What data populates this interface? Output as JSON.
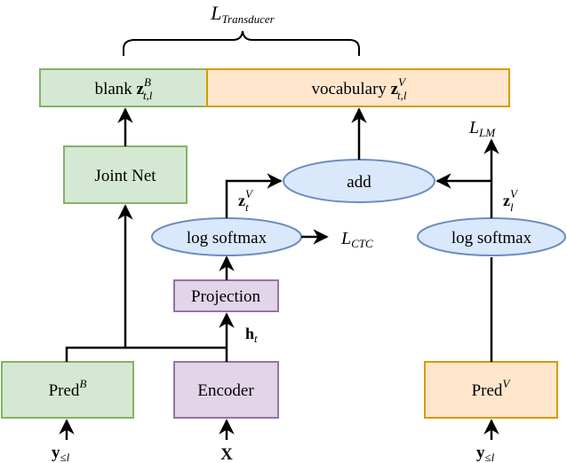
{
  "colors": {
    "green_fill": "#d5e8d4",
    "green_stroke": "#82b366",
    "orange_fill": "#ffe6cc",
    "orange_stroke": "#d79b00",
    "purple_fill": "#e1d5e7",
    "purple_stroke": "#9673a6",
    "blue_fill": "#dae8fc",
    "blue_stroke": "#6c8ebf",
    "line": "#000000"
  },
  "loss_transducer": {
    "symbol": "L",
    "subscript": "Transducer"
  },
  "loss_ctc": {
    "symbol": "L",
    "subscript": "CTC"
  },
  "loss_lm": {
    "symbol": "L",
    "subscript": "LM"
  },
  "output_blank": {
    "text": "blank ",
    "var": "z",
    "sup": "B",
    "sub": "t,l"
  },
  "output_vocab": {
    "text": "vocabulary ",
    "var": "z",
    "sup": "V",
    "sub": "t,l"
  },
  "joint_net": {
    "label": "Joint Net"
  },
  "add_node": {
    "label": "add"
  },
  "log_softmax_left": {
    "label": "log softmax"
  },
  "log_softmax_right": {
    "label": "log softmax"
  },
  "projection": {
    "label": "Projection"
  },
  "encoder": {
    "label": "Encoder"
  },
  "pred_blank": {
    "label": "Pred",
    "sup": "B"
  },
  "pred_vocab": {
    "label": "Pred",
    "sup": "V"
  },
  "z_t_label": {
    "var": "z",
    "sup": "V",
    "sub": "t"
  },
  "z_l_label": {
    "var": "z",
    "sup": "V",
    "sub": "l"
  },
  "h_t_label": {
    "var": "h",
    "sub": "t"
  },
  "input_y_left": {
    "var": "y",
    "sub": "≤l"
  },
  "input_x": {
    "var": "X"
  },
  "input_y_right": {
    "var": "y",
    "sub": "≤l"
  }
}
